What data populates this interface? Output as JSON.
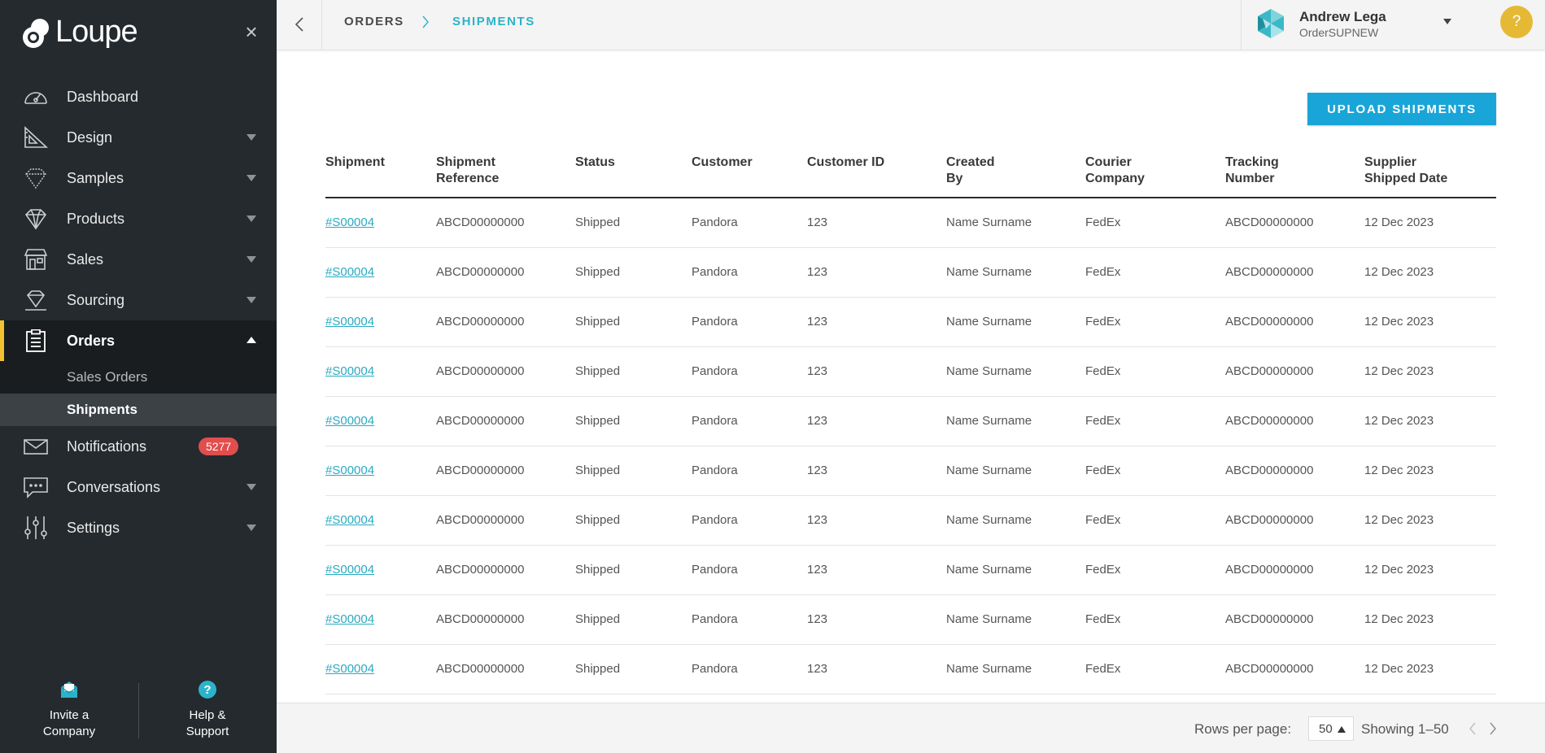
{
  "app": {
    "name": "Loupe"
  },
  "sidebar": {
    "items": [
      {
        "label": "Dashboard",
        "icon": "gauge-icon"
      },
      {
        "label": "Design",
        "icon": "design-tools-icon"
      },
      {
        "label": "Samples",
        "icon": "diamond-outline-icon"
      },
      {
        "label": "Products",
        "icon": "diamond-icon"
      },
      {
        "label": "Sales",
        "icon": "storefront-icon"
      },
      {
        "label": "Sourcing",
        "icon": "gem-sourcing-icon"
      },
      {
        "label": "Orders",
        "icon": "clipboard-icon"
      },
      {
        "label": "Notifications",
        "icon": "envelope-icon",
        "badge": "5277"
      },
      {
        "label": "Conversations",
        "icon": "chat-bubble-icon"
      },
      {
        "label": "Settings",
        "icon": "sliders-icon"
      }
    ],
    "orders_sub": [
      {
        "label": "Sales Orders"
      },
      {
        "label": "Shipments"
      }
    ],
    "bottom": {
      "invite_label": "Invite a Company",
      "help_label": "Help & Support"
    }
  },
  "breadcrumb": {
    "level1": "ORDERS",
    "level2": "SHIPMENTS"
  },
  "user": {
    "name": "Andrew Lega",
    "org": "OrderSUPNEW"
  },
  "help_button": "?",
  "actions": {
    "upload_label": "UPLOAD SHIPMENTS"
  },
  "table": {
    "headers": [
      [
        "Shipment"
      ],
      [
        "Shipment",
        "Reference"
      ],
      [
        "Status"
      ],
      [
        "Customer"
      ],
      [
        "Customer ID"
      ],
      [
        "Created",
        "By"
      ],
      [
        "Courier",
        "Company"
      ],
      [
        "Tracking",
        "Number"
      ],
      [
        "Supplier",
        "Shipped Date"
      ]
    ],
    "rows": [
      [
        "#S00004",
        "ABCD00000000",
        "Shipped",
        "Pandora",
        "123",
        "Name Surname",
        "FedEx",
        "ABCD00000000",
        "12 Dec 2023"
      ],
      [
        "#S00004",
        "ABCD00000000",
        "Shipped",
        "Pandora",
        "123",
        "Name Surname",
        "FedEx",
        "ABCD00000000",
        "12 Dec 2023"
      ],
      [
        "#S00004",
        "ABCD00000000",
        "Shipped",
        "Pandora",
        "123",
        "Name Surname",
        "FedEx",
        "ABCD00000000",
        "12 Dec 2023"
      ],
      [
        "#S00004",
        "ABCD00000000",
        "Shipped",
        "Pandora",
        "123",
        "Name Surname",
        "FedEx",
        "ABCD00000000",
        "12 Dec 2023"
      ],
      [
        "#S00004",
        "ABCD00000000",
        "Shipped",
        "Pandora",
        "123",
        "Name Surname",
        "FedEx",
        "ABCD00000000",
        "12 Dec 2023"
      ],
      [
        "#S00004",
        "ABCD00000000",
        "Shipped",
        "Pandora",
        "123",
        "Name Surname",
        "FedEx",
        "ABCD00000000",
        "12 Dec 2023"
      ],
      [
        "#S00004",
        "ABCD00000000",
        "Shipped",
        "Pandora",
        "123",
        "Name Surname",
        "FedEx",
        "ABCD00000000",
        "12 Dec 2023"
      ],
      [
        "#S00004",
        "ABCD00000000",
        "Shipped",
        "Pandora",
        "123",
        "Name Surname",
        "FedEx",
        "ABCD00000000",
        "12 Dec 2023"
      ],
      [
        "#S00004",
        "ABCD00000000",
        "Shipped",
        "Pandora",
        "123",
        "Name Surname",
        "FedEx",
        "ABCD00000000",
        "12 Dec 2023"
      ],
      [
        "#S00004",
        "ABCD00000000",
        "Shipped",
        "Pandora",
        "123",
        "Name Surname",
        "FedEx",
        "ABCD00000000",
        "12 Dec 2023"
      ]
    ]
  },
  "footer": {
    "rows_per_page_label": "Rows per page:",
    "rows_per_page_value": "50",
    "showing": "Showing 1–50"
  },
  "colors": {
    "sidebar_bg": "#242a2e",
    "active_accent": "#f2c230",
    "link": "#2aaac2",
    "primary_button": "#19a5d8",
    "badge": "#e24d4d",
    "help": "#e6b935"
  }
}
